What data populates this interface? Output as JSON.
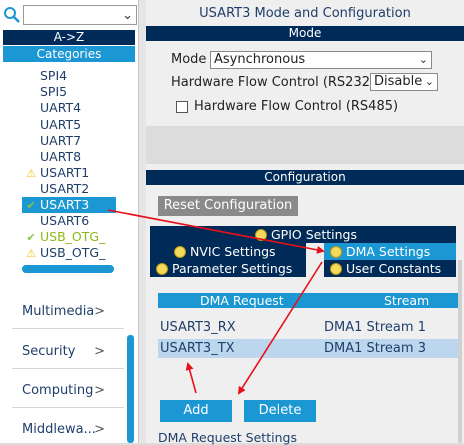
{
  "left_panel": {
    "search_value": "",
    "az_label": "A->Z",
    "categories_label": "Categories",
    "peripherals": [
      {
        "label": "SPI4",
        "icon": "",
        "state": "normal"
      },
      {
        "label": "SPI5",
        "icon": "",
        "state": "normal"
      },
      {
        "label": "UART4",
        "icon": "",
        "state": "normal"
      },
      {
        "label": "UART5",
        "icon": "",
        "state": "normal"
      },
      {
        "label": "UART7",
        "icon": "",
        "state": "normal"
      },
      {
        "label": "UART8",
        "icon": "",
        "state": "normal"
      },
      {
        "label": "USART1",
        "icon": "warning-icon",
        "state": "warning"
      },
      {
        "label": "USART2",
        "icon": "",
        "state": "normal"
      },
      {
        "label": "USART3",
        "icon": "checkmark-icon",
        "state": "selected"
      },
      {
        "label": "USART6",
        "icon": "",
        "state": "normal"
      },
      {
        "label": "USB_OTG_",
        "icon": "checkmark-icon",
        "state": "enabled"
      },
      {
        "label": "USB_OTG_",
        "icon": "warning-icon",
        "state": "warning"
      }
    ],
    "categories": [
      {
        "label": "Multimedia",
        "chevron": ">"
      },
      {
        "label": "Security",
        "chevron": ">"
      },
      {
        "label": "Computing",
        "chevron": ">"
      },
      {
        "label": "Middlewa...",
        "chevron": ">"
      }
    ]
  },
  "right_panel": {
    "title": "USART3 Mode and Configuration",
    "mode_section_label": "Mode",
    "mode_label": "Mode",
    "mode_value": "Asynchronous",
    "hw_flow_rs232_label": "Hardware Flow Control (RS232)",
    "hw_flow_rs232_value": "Disable",
    "hw_flow_rs485_label": "Hardware Flow Control (RS485)",
    "hw_flow_rs485_checked": false,
    "config_section_label": "Configuration",
    "reset_button_label": "Reset Configuration",
    "tabs": {
      "gpio": "GPIO Settings",
      "nvic": "NVIC Settings",
      "dma": "DMA Settings",
      "parameter": "Parameter Settings",
      "user_constants": "User Constants"
    },
    "active_tab": "dma",
    "dma_table": {
      "headers": [
        "DMA Request",
        "Stream"
      ],
      "rows": [
        {
          "request": "USART3_RX",
          "stream": "DMA1 Stream 1",
          "selected": false
        },
        {
          "request": "USART3_TX",
          "stream": "DMA1 Stream 3",
          "selected": true
        }
      ]
    },
    "add_button_label": "Add",
    "delete_button_label": "Delete",
    "dma_request_settings_label": "DMA Request Settings"
  },
  "colors": {
    "navy": "#002a57",
    "accent_blue": "#1b97d4",
    "selected_row": "#bcd6ee",
    "annotation_red": "#e8101a",
    "warning_yellow": "#f3c21c",
    "ok_green": "#8bc53f"
  }
}
